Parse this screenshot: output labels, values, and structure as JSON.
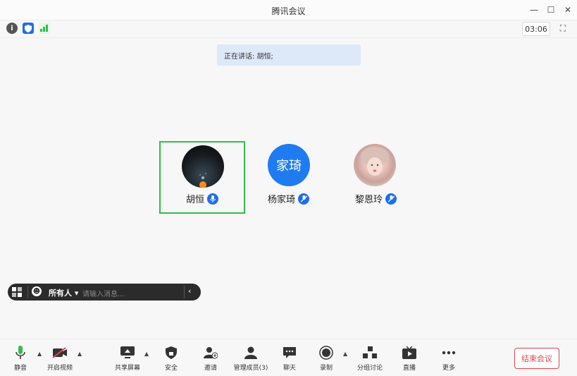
{
  "window": {
    "title": "腾讯会议",
    "minimize_glyph": "—",
    "maximize_glyph": "☐",
    "close_glyph": "✕"
  },
  "topbar": {
    "timer": "03:06"
  },
  "speaking": {
    "text": "正在讲话: 胡恒;"
  },
  "participants": [
    {
      "name": "胡恒",
      "avatar_text": ""
    },
    {
      "name": "杨家琦",
      "avatar_text": "家琦"
    },
    {
      "name": "黎恩玲",
      "avatar_text": ""
    }
  ],
  "chat": {
    "recipient": "所有人",
    "placeholder": "请输入消息..."
  },
  "toolbar": [
    {
      "label": "静音",
      "icon": "mic-icon"
    },
    {
      "label": "开启视频",
      "icon": "camera-off-icon"
    },
    {
      "label": "共享屏幕",
      "icon": "share-screen-icon"
    },
    {
      "label": "安全",
      "icon": "shield-icon"
    },
    {
      "label": "邀请",
      "icon": "invite-icon"
    },
    {
      "label": "管理成员(3)",
      "icon": "members-icon"
    },
    {
      "label": "聊天",
      "icon": "chat-icon"
    },
    {
      "label": "录制",
      "icon": "record-icon"
    },
    {
      "label": "分组讨论",
      "icon": "breakout-icon"
    },
    {
      "label": "直播",
      "icon": "live-icon"
    },
    {
      "label": "更多",
      "icon": "more-icon"
    }
  ],
  "end_button": "结束会议",
  "colors": {
    "accent": "#1e6fe8",
    "active_border": "#2fbf47",
    "danger": "#e0454b",
    "speaking_bg": "#dde8f8"
  }
}
